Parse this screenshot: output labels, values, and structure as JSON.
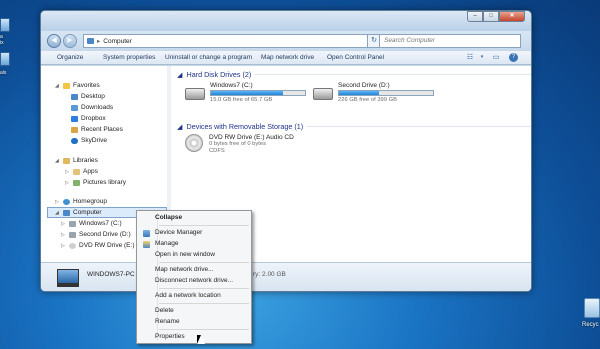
{
  "desktop": {
    "left_labels": [
      "a",
      "ix",
      "als"
    ],
    "recycle_label": "Recyc"
  },
  "window": {
    "address": "Computer",
    "search_placeholder": "Search Computer",
    "toolbar": [
      "Organize",
      "System properties",
      "Uninstall or change a program",
      "Map network drive",
      "Open Control Panel"
    ],
    "nav": {
      "favorites": "Favorites",
      "fav_items": [
        "Desktop",
        "Downloads",
        "Dropbox",
        "Recent Places",
        "SkyDrive"
      ],
      "libraries": "Libraries",
      "lib_items": [
        "Apps",
        "Pictures library"
      ],
      "homegroup": "Homegroup",
      "computer": "Computer",
      "computer_items": [
        "Windows7 (C:)",
        "Second Drive (D:)",
        "DVD RW Drive (E:) Audio"
      ]
    },
    "groups": {
      "hdd": "Hard Disk Drives (2)",
      "removable": "Devices with Removable Storage (1)"
    },
    "drives": [
      {
        "name": "Windows7 (C:)",
        "free": "15.0 GB free of 65.7 GB",
        "used_fraction": 0.77
      },
      {
        "name": "Second Drive (D:)",
        "free": "226 GB free of 399 GB",
        "used_fraction": 0.43
      }
    ],
    "removable": {
      "name": "DVD RW Drive (E:) Audio CD",
      "free": "0 bytes free of 0 bytes",
      "fs": "CDFS"
    },
    "details": {
      "pc_name": "WINDOWS7-PC",
      "memory": "ry: 2.00 GB"
    }
  },
  "context_menu": {
    "items": [
      "Collapse",
      "Device Manager",
      "Manage",
      "Open in new window",
      "Map network drive...",
      "Disconnect network drive...",
      "Add a network location",
      "Delete",
      "Rename",
      "Properties"
    ]
  },
  "colors": {
    "accent": "#2183d9",
    "group_header": "#1e3287",
    "selection": "#dcebfc"
  }
}
